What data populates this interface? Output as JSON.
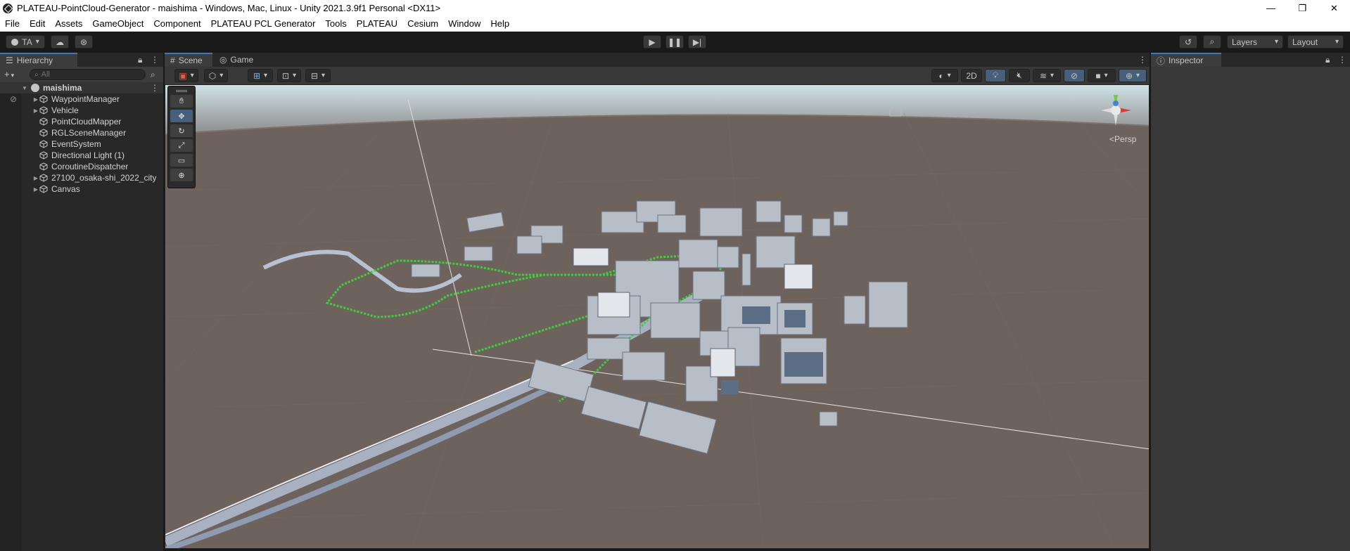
{
  "window": {
    "title": "PLATEAU-PointCloud-Generator - maishima - Windows, Mac, Linux - Unity 2021.3.9f1 Personal <DX11>",
    "controls": [
      "—",
      "❐",
      "✕"
    ]
  },
  "menu": [
    "File",
    "Edit",
    "Assets",
    "GameObject",
    "Component",
    "PLATEAU PCL Generator",
    "Tools",
    "PLATEAU",
    "Cesium",
    "Window",
    "Help"
  ],
  "toolbar": {
    "account": "TA",
    "layers": "Layers",
    "layout": "Layout"
  },
  "hierarchy": {
    "tab": "Hierarchy",
    "search_placeholder": "All",
    "scene": "maishima",
    "items": [
      {
        "label": "WaypointManager",
        "expandable": true
      },
      {
        "label": "Vehicle",
        "expandable": true
      },
      {
        "label": "PointCloudMapper",
        "expandable": false
      },
      {
        "label": "RGLSceneManager",
        "expandable": false
      },
      {
        "label": "EventSystem",
        "expandable": false
      },
      {
        "label": "Directional Light (1)",
        "expandable": false
      },
      {
        "label": "CoroutineDispatcher",
        "expandable": false
      },
      {
        "label": "27100_osaka-shi_2022_city",
        "expandable": true
      },
      {
        "label": "Canvas",
        "expandable": true
      }
    ]
  },
  "scene_tabs": {
    "scene": "Scene",
    "game": "Game"
  },
  "scene_view": {
    "mode_2d": "2D",
    "projection": "Persp"
  },
  "inspector": {
    "tab": "Inspector"
  },
  "colors": {
    "accent": "#3a79bb",
    "ground": "#6e625c",
    "sky": "#cfe1e6",
    "path": "#3cd13c"
  }
}
